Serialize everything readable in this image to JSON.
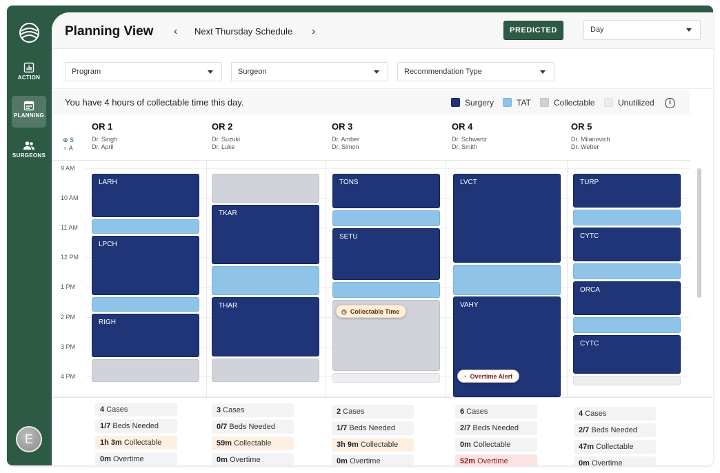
{
  "app": {
    "avatar_initial": "E"
  },
  "sidebar": {
    "items": [
      {
        "label": "ACTION",
        "icon": "bar-chart-icon"
      },
      {
        "label": "PLANNING",
        "icon": "calendar-icon"
      },
      {
        "label": "SURGEONS",
        "icon": "people-icon"
      }
    ]
  },
  "header": {
    "title": "Planning View",
    "schedule": "Next Thursday Schedule",
    "predicted_label": "PREDICTED",
    "view_select": "Day"
  },
  "filters": {
    "program": "Program",
    "surgeon": "Surgeon",
    "recommendation": "Recommendation Type"
  },
  "info": {
    "message": "You have 4 hours of collectable time this day.",
    "legend": [
      {
        "label": "Surgery",
        "color": "#1f3578"
      },
      {
        "label": "TAT",
        "color": "#8fc4e8"
      },
      {
        "label": "Collectable",
        "color": "#d0d3d9"
      },
      {
        "label": "Unutilized",
        "color": "#ededf0"
      }
    ],
    "info_glyph": "i"
  },
  "roles": {
    "s": "S",
    "a": "A"
  },
  "times": [
    "9 AM",
    "10 AM",
    "11 AM",
    "12 PM",
    "1 PM",
    "2 PM",
    "3 PM",
    "4 PM"
  ],
  "rooms": [
    {
      "name": "OR 1",
      "surgeon": "Dr. Singh",
      "assistant": "Dr. April"
    },
    {
      "name": "OR 2",
      "surgeon": "Dr. Suzuki",
      "assistant": "Dr. Luke"
    },
    {
      "name": "OR 3",
      "surgeon": "Dr. Amber",
      "assistant": "Dr. Simon"
    },
    {
      "name": "OR 4",
      "surgeon": "Dr. Schwartz",
      "assistant": "Dr. Smith"
    },
    {
      "name": "OR 5",
      "surgeon": "Dr. Milanovich",
      "assistant": "Dr. Weber"
    }
  ],
  "procedures": {
    "or1": [
      "LARH",
      "LPCH",
      "RIGH"
    ],
    "or2": [
      "TKAR",
      "THAR"
    ],
    "or3": [
      "TONS",
      "SETU"
    ],
    "or4": [
      "LVCT",
      "VAHY"
    ],
    "or5": [
      "TURP",
      "CYTC",
      "ORCA",
      "CYTC"
    ]
  },
  "callouts": {
    "collectable": "Collectable Time",
    "overtime": "Overtime Alert"
  },
  "stats": [
    {
      "cases": "4",
      "cases_label": " Cases",
      "beds": "1/7",
      "beds_label": " Beds Needed",
      "collectable": "1h 3m",
      "collectable_label": " Collectable",
      "overtime": "0m",
      "overtime_label": " Overtime"
    },
    {
      "cases": "3",
      "cases_label": " Cases",
      "beds": "0/7",
      "beds_label": " Beds Needed",
      "collectable": "59m",
      "collectable_label": " Collectable",
      "overtime": "0m",
      "overtime_label": " Overtime"
    },
    {
      "cases": "2",
      "cases_label": " Cases",
      "beds": "1/7",
      "beds_label": " Beds Needed",
      "collectable": "3h 9m",
      "collectable_label": " Collectable",
      "overtime": "0m",
      "overtime_label": " Overtime"
    },
    {
      "cases": "6",
      "cases_label": " Cases",
      "beds": "2/7",
      "beds_label": " Beds Needed",
      "collectable": "0m",
      "collectable_label": " Collectable",
      "overtime": "52m",
      "overtime_label": " Overtime"
    },
    {
      "cases": "4",
      "cases_label": " Cases",
      "beds": "2/7",
      "beds_label": " Beds Needed",
      "collectable": "47m",
      "collectable_label": " Collectable",
      "overtime": "0m",
      "overtime_label": " Overtime"
    }
  ]
}
